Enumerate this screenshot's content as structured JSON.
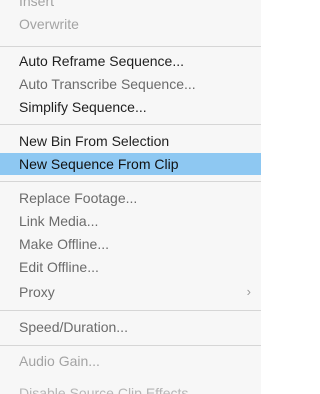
{
  "menu": {
    "items": [
      {
        "label": "Insert",
        "state": "disabled"
      },
      {
        "label": "Overwrite",
        "state": "disabled"
      },
      {
        "label": "Auto Reframe Sequence...",
        "state": "normal"
      },
      {
        "label": "Auto Transcribe Sequence...",
        "state": "secondary"
      },
      {
        "label": "Simplify Sequence...",
        "state": "normal"
      },
      {
        "label": "New Bin From Selection",
        "state": "normal"
      },
      {
        "label": "New Sequence From Clip",
        "state": "highlighted"
      },
      {
        "label": "Replace Footage...",
        "state": "secondary"
      },
      {
        "label": "Link Media...",
        "state": "secondary"
      },
      {
        "label": "Make Offline...",
        "state": "secondary"
      },
      {
        "label": "Edit Offline...",
        "state": "secondary"
      },
      {
        "label": "Proxy",
        "state": "secondary",
        "submenu_icon": "chevron-right-icon",
        "submenu_glyph": "›"
      },
      {
        "label": "Speed/Duration...",
        "state": "secondary"
      },
      {
        "label": "Audio Gain...",
        "state": "disabled"
      },
      {
        "label": "Disable Source Clip Effects",
        "state": "faded"
      }
    ]
  },
  "colors": {
    "menu_background": "#f7f7f7",
    "highlight": "#8ec8f2",
    "text": "#1f1f1f",
    "disabled_text": "#a3a3a3",
    "divider": "#d6d6d6"
  }
}
